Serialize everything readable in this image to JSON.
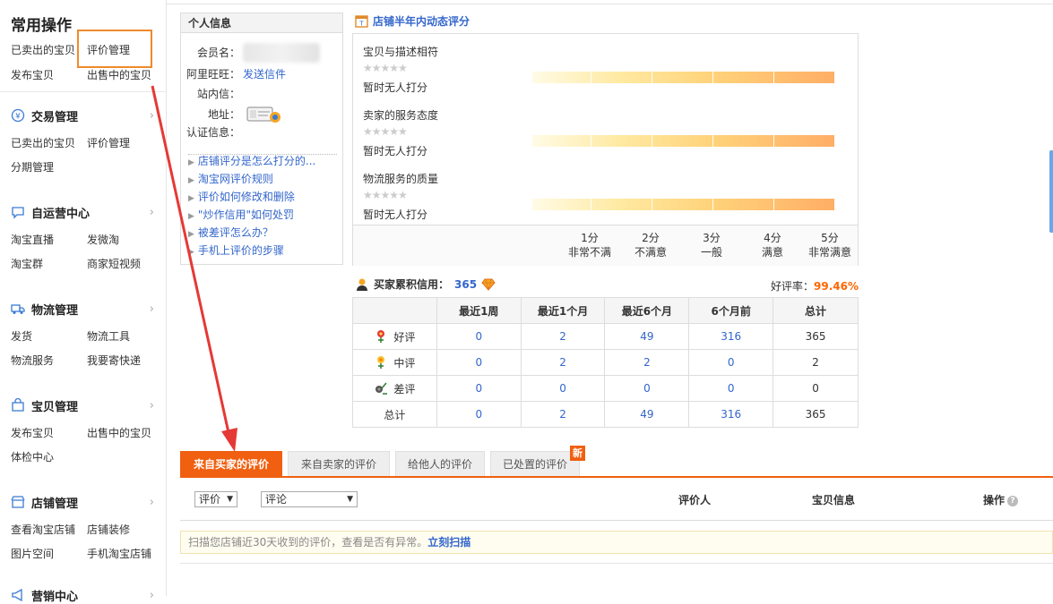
{
  "sidebar": {
    "quick_title": "常用操作",
    "quick_items": [
      "已卖出的宝贝",
      "评价管理",
      "发布宝贝",
      "出售中的宝贝"
    ],
    "sections": [
      {
        "title": "交易管理",
        "icon": "yen-icon",
        "items": [
          "已卖出的宝贝",
          "评价管理",
          "分期管理"
        ]
      },
      {
        "title": "自运营中心",
        "icon": "chat-icon",
        "items": [
          "淘宝直播",
          "发微淘",
          "淘宝群",
          "商家短视频"
        ]
      },
      {
        "title": "物流管理",
        "icon": "truck-icon",
        "items": [
          "发货",
          "物流工具",
          "物流服务",
          "我要寄快递"
        ]
      },
      {
        "title": "宝贝管理",
        "icon": "bag-icon",
        "items": [
          "发布宝贝",
          "出售中的宝贝",
          "体检中心"
        ]
      },
      {
        "title": "店铺管理",
        "icon": "shop-icon",
        "items": [
          "查看淘宝店铺",
          "店铺装修",
          "图片空间",
          "手机淘宝店铺"
        ]
      },
      {
        "title": "营销中心",
        "icon": "megaphone-icon",
        "items": []
      }
    ]
  },
  "info": {
    "title": "个人信息",
    "member_label": "会员名：",
    "wangwang_label": "阿里旺旺：",
    "wangwang_link": "发送信件",
    "station_label": "站内信：",
    "address_label": "地址：",
    "cert_label": "认证信息：",
    "help_links": [
      "店铺评分是怎么打分的...",
      "淘宝网评价规则",
      "评价如何修改和删除",
      "\"炒作信用\"如何处罚",
      "被差评怎么办？",
      "手机上评价的步骤"
    ]
  },
  "dynamic": {
    "title": "店铺半年内动态评分",
    "items": [
      {
        "title": "宝贝与描述相符",
        "status": "暂时无人打分",
        "stars": "★★★★★"
      },
      {
        "title": "卖家的服务态度",
        "status": "暂时无人打分",
        "stars": "★★★★★"
      },
      {
        "title": "物流服务的质量",
        "status": "暂时无人打分",
        "stars": "★★★★★"
      }
    ],
    "scale": [
      {
        "score": "1分",
        "desc": "非常不满"
      },
      {
        "score": "2分",
        "desc": "不满意"
      },
      {
        "score": "3分",
        "desc": "一般"
      },
      {
        "score": "4分",
        "desc": "满意"
      },
      {
        "score": "5分",
        "desc": "非常满意"
      }
    ]
  },
  "credit": {
    "label": "买家累积信用：",
    "value": "365",
    "good_rate_label": "好评率：",
    "good_rate": "99.46%",
    "headers": [
      "",
      "最近1周",
      "最近1个月",
      "最近6个月",
      "6个月前",
      "总计"
    ],
    "rows": [
      {
        "label": "好评",
        "values": [
          "0",
          "2",
          "49",
          "316",
          "365"
        ]
      },
      {
        "label": "中评",
        "values": [
          "0",
          "2",
          "2",
          "0",
          "2"
        ]
      },
      {
        "label": "差评",
        "values": [
          "0",
          "0",
          "0",
          "0",
          "0"
        ]
      },
      {
        "label": "总计",
        "values": [
          "0",
          "2",
          "49",
          "316",
          "365"
        ]
      }
    ]
  },
  "tabs": [
    "来自买家的评价",
    "来自卖家的评价",
    "给他人的评价",
    "已处置的评价"
  ],
  "new_badge": "新",
  "filter": {
    "select1": "评价",
    "select2": "评论",
    "col_rater": "评价人",
    "col_item": "宝贝信息",
    "col_action": "操作",
    "help": "?"
  },
  "scan": {
    "text": "扫描您店铺近30天收到的评价，查看是否有异常。",
    "link": "立刻扫描"
  },
  "colors": {
    "accent": "#f06010",
    "link": "#3366cc",
    "highlight": "#f08a2c"
  }
}
